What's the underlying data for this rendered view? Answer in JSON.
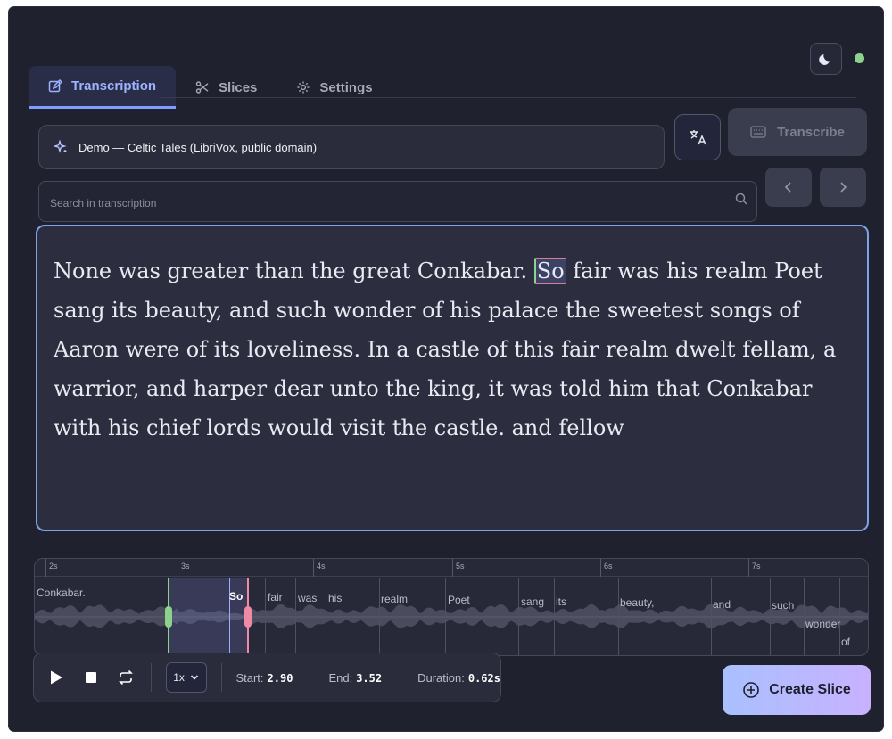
{
  "tabs": [
    {
      "label": "Transcription",
      "icon": "edit-icon",
      "active": true
    },
    {
      "label": "Slices",
      "icon": "scissors-icon",
      "active": false
    },
    {
      "label": "Settings",
      "icon": "gear-icon",
      "active": false
    }
  ],
  "source": {
    "selected": "Demo — Celtic Tales (LibriVox, public domain)"
  },
  "transcribe_label": "Transcribe",
  "search": {
    "placeholder": "Search in transcription",
    "value": ""
  },
  "transcript": {
    "before": "None was greater than the great Conkabar. ",
    "highlight": "So",
    "after": " fair was his realm Poet sang its beauty, and such wonder of his palace the sweetest songs of Aaron were of its loveliness. In a castle of this fair realm dwelt fellam, a warrior, and harper dear unto the king, it was told him that Conkabar with his chief lords would visit the castle. and fellow"
  },
  "waveform": {
    "ticks": [
      "2s",
      "3s",
      "4s",
      "5s",
      "6s",
      "7s"
    ],
    "words": [
      "Conkabar.",
      "So",
      "fair",
      "was",
      "his",
      "realm",
      "Poet",
      "sang",
      "its",
      "beauty,",
      "and",
      "such",
      "wonder",
      "of"
    ],
    "active_word": "So"
  },
  "transport": {
    "speed": "1x",
    "start_label": "Start:",
    "start_value": "2.90",
    "end_label": "End:",
    "end_value": "3.52",
    "duration_label": "Duration:",
    "duration_value": "0.62s"
  },
  "create_slice_label": "Create Slice",
  "colors": {
    "accent": "#7f9cff",
    "start_handle": "#8ed18c",
    "end_handle": "#f08aa4",
    "status": "#8ed18c"
  }
}
